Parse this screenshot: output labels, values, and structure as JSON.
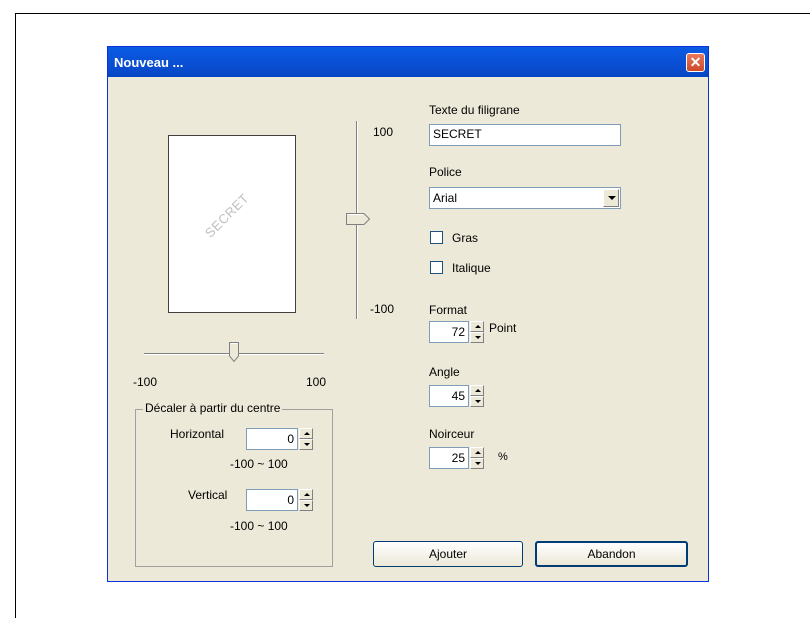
{
  "window": {
    "title": "Nouveau ...",
    "close_symbol": "✕"
  },
  "preview": {
    "watermark_text": "SECRET"
  },
  "hslider": {
    "min_label": "-100",
    "max_label": "100"
  },
  "vslider": {
    "max_label": "100",
    "min_label": "-100"
  },
  "offset_group": {
    "legend": "Décaler à partir du centre",
    "horizontal_label": "Horizontal",
    "horizontal_value": "0",
    "horizontal_range": "-100 ~ 100",
    "vertical_label": "Vertical",
    "vertical_value": "0",
    "vertical_range": "-100 ~ 100"
  },
  "watermark_text": {
    "label": "Texte du filigrane",
    "value": "SECRET"
  },
  "font": {
    "label": "Police",
    "value": "Arial"
  },
  "bold": {
    "label": "Gras",
    "checked": false
  },
  "italic": {
    "label": "Italique",
    "checked": false
  },
  "size": {
    "label": "Format",
    "value": "72",
    "unit": "Point"
  },
  "angle": {
    "label": "Angle",
    "value": "45"
  },
  "darkness": {
    "label": "Noirceur",
    "value": "25",
    "unit": "%"
  },
  "buttons": {
    "add": "Ajouter",
    "cancel": "Abandon"
  },
  "colors": {
    "titlebar": "#0a4ed2",
    "dialog_bg": "#ece9d8",
    "close": "#d8593a"
  }
}
